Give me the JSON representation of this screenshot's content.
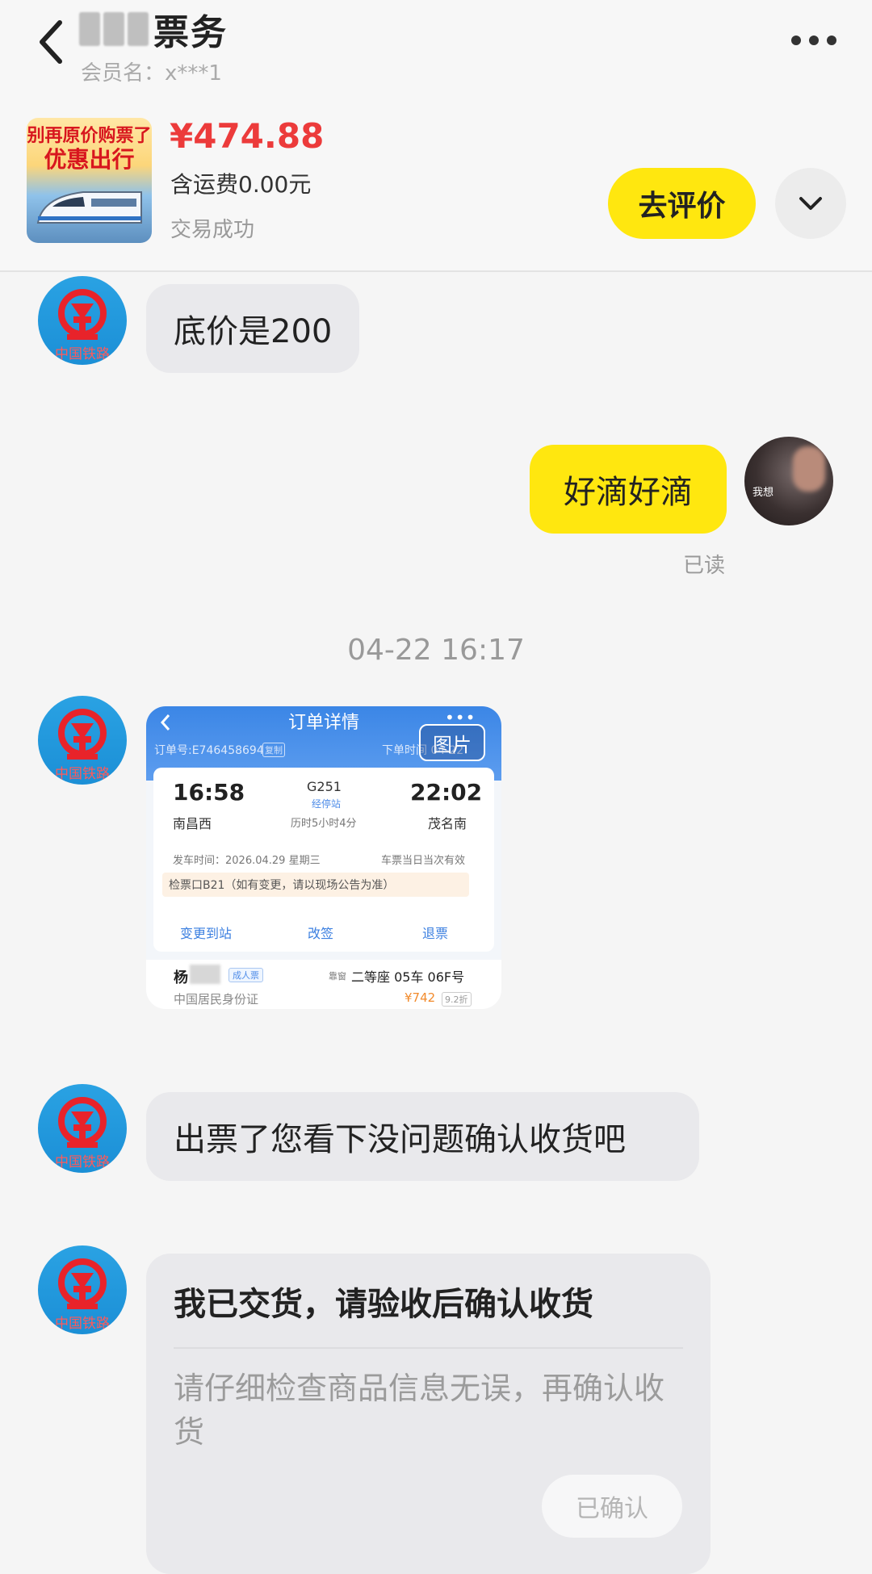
{
  "header": {
    "title": "票务",
    "member_label": "会员名：x***1"
  },
  "product": {
    "thumb_line1": "别再原价购票了",
    "thumb_line2": "优惠出行",
    "price": "¥474.88",
    "shipping": "含运费0.00元",
    "status": "交易成功",
    "review_button": "去评价"
  },
  "messages": {
    "m1": "底价是200",
    "m2": "好滴好滴",
    "read_status": "已读",
    "timestamp": "04-22 16:17",
    "m4": "出票了您看下没问题确认收货吧",
    "avatar_text": "中国铁路",
    "user_avatar_text": "我想"
  },
  "ticket_image": {
    "title": "订单详情",
    "order_no": "订单号:E746458694",
    "copy_label": "复制",
    "order_time": "下单时间 04-22",
    "image_tag": "图片",
    "depart_time": "16:58",
    "arrive_time": "22:02",
    "train_no": "G251",
    "via": "经停站",
    "duration": "历时5小时4分",
    "from_station": "南昌西",
    "to_station": "茂名南",
    "depart_date": "发车时间：2026.04.29 星期三",
    "valid_note": "车票当日当次有效",
    "gate": "检票口B21（如有变更，请以现场公告为准）",
    "actions": [
      "变更到站",
      "改签",
      "退票"
    ],
    "passenger_name": "杨",
    "passenger_type": "成人票",
    "seat_label": "靠窗",
    "seat": "二等座 05车 06F号",
    "id_type": "中国居民身份证",
    "price": "¥742",
    "discount": "9.2折"
  },
  "delivery": {
    "title": "我已交货，请验收后确认收货",
    "desc": "请仔细检查商品信息无误，再确认收货",
    "button": "已确认"
  },
  "colors": {
    "accent_yellow": "#ffe70f",
    "price_red": "#ec3b3b",
    "bubble_grey": "#e9e9ec"
  },
  "icons": [
    "back-icon",
    "more-icon",
    "chevron-down-icon",
    "railway-logo-icon"
  ]
}
